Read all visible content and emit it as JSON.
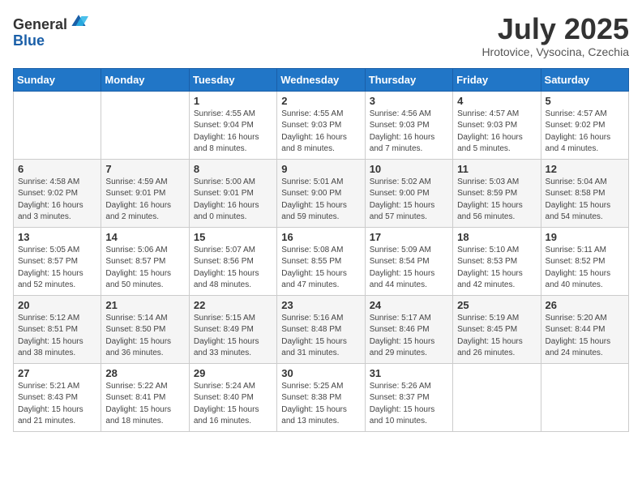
{
  "header": {
    "logo_general": "General",
    "logo_blue": "Blue",
    "month": "July 2025",
    "location": "Hrotovice, Vysocina, Czechia"
  },
  "weekdays": [
    "Sunday",
    "Monday",
    "Tuesday",
    "Wednesday",
    "Thursday",
    "Friday",
    "Saturday"
  ],
  "weeks": [
    [
      {
        "day": "",
        "info": ""
      },
      {
        "day": "",
        "info": ""
      },
      {
        "day": "1",
        "info": "Sunrise: 4:55 AM\nSunset: 9:04 PM\nDaylight: 16 hours and 8 minutes."
      },
      {
        "day": "2",
        "info": "Sunrise: 4:55 AM\nSunset: 9:03 PM\nDaylight: 16 hours and 8 minutes."
      },
      {
        "day": "3",
        "info": "Sunrise: 4:56 AM\nSunset: 9:03 PM\nDaylight: 16 hours and 7 minutes."
      },
      {
        "day": "4",
        "info": "Sunrise: 4:57 AM\nSunset: 9:03 PM\nDaylight: 16 hours and 5 minutes."
      },
      {
        "day": "5",
        "info": "Sunrise: 4:57 AM\nSunset: 9:02 PM\nDaylight: 16 hours and 4 minutes."
      }
    ],
    [
      {
        "day": "6",
        "info": "Sunrise: 4:58 AM\nSunset: 9:02 PM\nDaylight: 16 hours and 3 minutes."
      },
      {
        "day": "7",
        "info": "Sunrise: 4:59 AM\nSunset: 9:01 PM\nDaylight: 16 hours and 2 minutes."
      },
      {
        "day": "8",
        "info": "Sunrise: 5:00 AM\nSunset: 9:01 PM\nDaylight: 16 hours and 0 minutes."
      },
      {
        "day": "9",
        "info": "Sunrise: 5:01 AM\nSunset: 9:00 PM\nDaylight: 15 hours and 59 minutes."
      },
      {
        "day": "10",
        "info": "Sunrise: 5:02 AM\nSunset: 9:00 PM\nDaylight: 15 hours and 57 minutes."
      },
      {
        "day": "11",
        "info": "Sunrise: 5:03 AM\nSunset: 8:59 PM\nDaylight: 15 hours and 56 minutes."
      },
      {
        "day": "12",
        "info": "Sunrise: 5:04 AM\nSunset: 8:58 PM\nDaylight: 15 hours and 54 minutes."
      }
    ],
    [
      {
        "day": "13",
        "info": "Sunrise: 5:05 AM\nSunset: 8:57 PM\nDaylight: 15 hours and 52 minutes."
      },
      {
        "day": "14",
        "info": "Sunrise: 5:06 AM\nSunset: 8:57 PM\nDaylight: 15 hours and 50 minutes."
      },
      {
        "day": "15",
        "info": "Sunrise: 5:07 AM\nSunset: 8:56 PM\nDaylight: 15 hours and 48 minutes."
      },
      {
        "day": "16",
        "info": "Sunrise: 5:08 AM\nSunset: 8:55 PM\nDaylight: 15 hours and 47 minutes."
      },
      {
        "day": "17",
        "info": "Sunrise: 5:09 AM\nSunset: 8:54 PM\nDaylight: 15 hours and 44 minutes."
      },
      {
        "day": "18",
        "info": "Sunrise: 5:10 AM\nSunset: 8:53 PM\nDaylight: 15 hours and 42 minutes."
      },
      {
        "day": "19",
        "info": "Sunrise: 5:11 AM\nSunset: 8:52 PM\nDaylight: 15 hours and 40 minutes."
      }
    ],
    [
      {
        "day": "20",
        "info": "Sunrise: 5:12 AM\nSunset: 8:51 PM\nDaylight: 15 hours and 38 minutes."
      },
      {
        "day": "21",
        "info": "Sunrise: 5:14 AM\nSunset: 8:50 PM\nDaylight: 15 hours and 36 minutes."
      },
      {
        "day": "22",
        "info": "Sunrise: 5:15 AM\nSunset: 8:49 PM\nDaylight: 15 hours and 33 minutes."
      },
      {
        "day": "23",
        "info": "Sunrise: 5:16 AM\nSunset: 8:48 PM\nDaylight: 15 hours and 31 minutes."
      },
      {
        "day": "24",
        "info": "Sunrise: 5:17 AM\nSunset: 8:46 PM\nDaylight: 15 hours and 29 minutes."
      },
      {
        "day": "25",
        "info": "Sunrise: 5:19 AM\nSunset: 8:45 PM\nDaylight: 15 hours and 26 minutes."
      },
      {
        "day": "26",
        "info": "Sunrise: 5:20 AM\nSunset: 8:44 PM\nDaylight: 15 hours and 24 minutes."
      }
    ],
    [
      {
        "day": "27",
        "info": "Sunrise: 5:21 AM\nSunset: 8:43 PM\nDaylight: 15 hours and 21 minutes."
      },
      {
        "day": "28",
        "info": "Sunrise: 5:22 AM\nSunset: 8:41 PM\nDaylight: 15 hours and 18 minutes."
      },
      {
        "day": "29",
        "info": "Sunrise: 5:24 AM\nSunset: 8:40 PM\nDaylight: 15 hours and 16 minutes."
      },
      {
        "day": "30",
        "info": "Sunrise: 5:25 AM\nSunset: 8:38 PM\nDaylight: 15 hours and 13 minutes."
      },
      {
        "day": "31",
        "info": "Sunrise: 5:26 AM\nSunset: 8:37 PM\nDaylight: 15 hours and 10 minutes."
      },
      {
        "day": "",
        "info": ""
      },
      {
        "day": "",
        "info": ""
      }
    ]
  ]
}
